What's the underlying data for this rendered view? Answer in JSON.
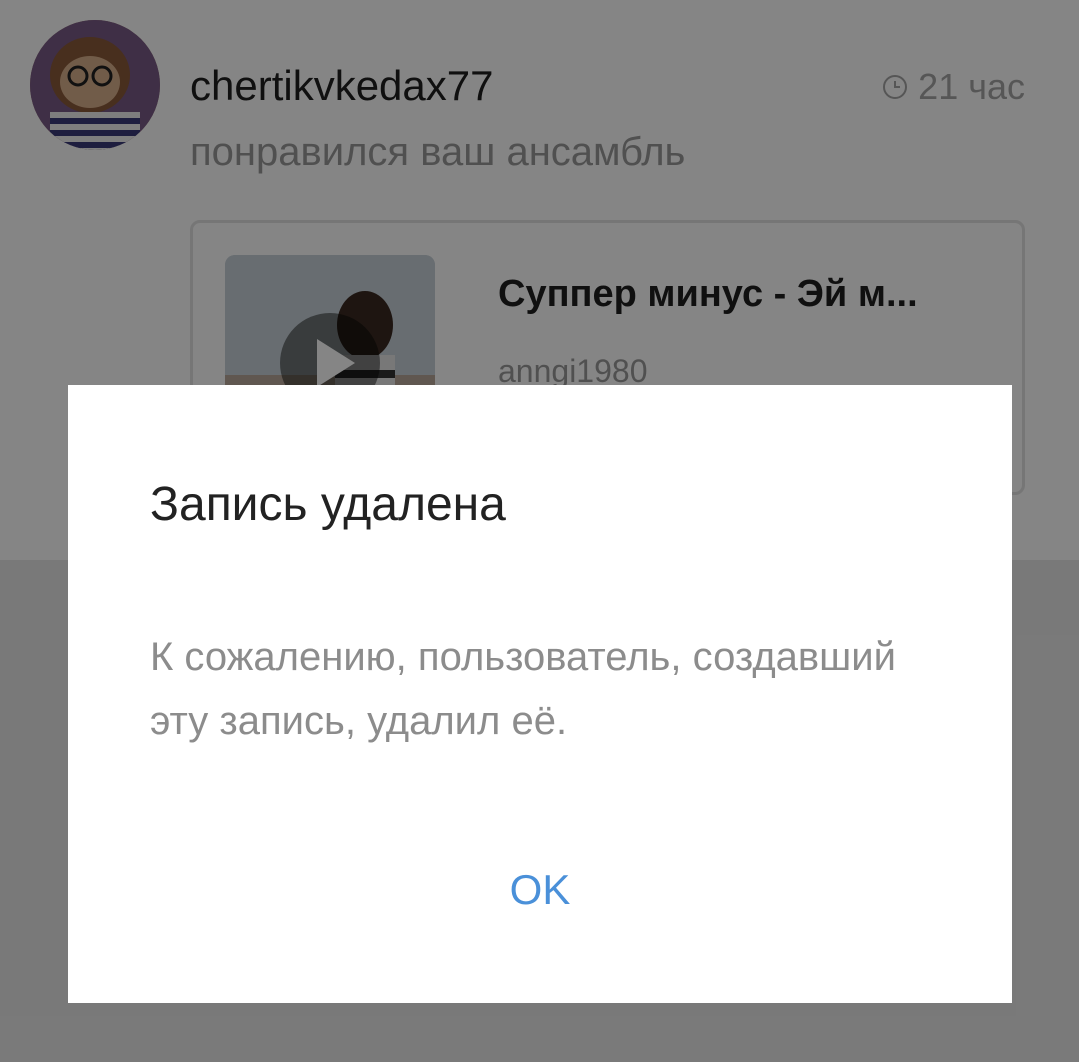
{
  "notification": {
    "username": "chertikvkedax77",
    "time": "21 час",
    "action": "понравился ваш ансамбль",
    "ensemble": {
      "title": "Суппер минус - Эй м...",
      "author": "anngi1980"
    },
    "icons": {
      "clock": "clock-icon",
      "play": "play-icon"
    }
  },
  "dialog": {
    "title": "Запись удалена",
    "message": "К сожалению, пользователь, создавший эту запись, удалил её.",
    "ok_label": "OK"
  },
  "colors": {
    "accent": "#4a90d9",
    "overlay": "rgba(0,0,0,0.48)",
    "title_text": "#222222",
    "secondary_text": "#8c8c8c"
  }
}
